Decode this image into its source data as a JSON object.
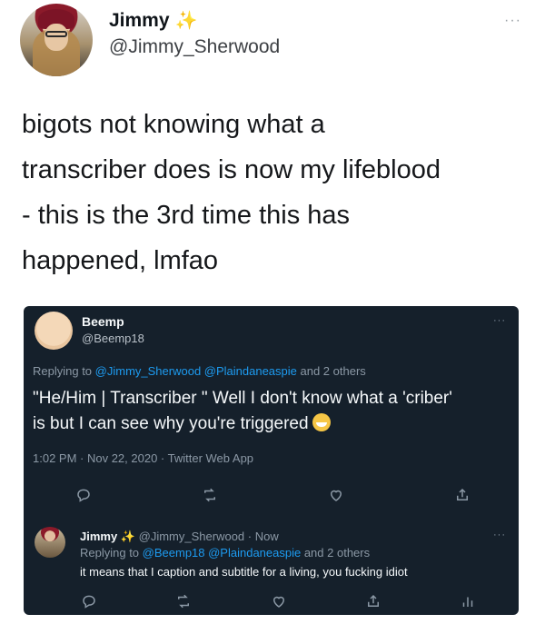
{
  "outer_tweet": {
    "display_name": "Jimmy",
    "verified_sparkle": "✨",
    "handle": "@Jimmy_Sherwood",
    "more": "···",
    "text_lines": [
      "bigots not knowing what a",
      "transcriber does is now my lifeblood",
      "- this is the 3rd time this has",
      "happened, lmfao"
    ]
  },
  "quoted_screenshot": {
    "theme": {
      "background": "#15202b",
      "link": "#1d9bf0",
      "muted": "#8b98a5"
    },
    "beemp_tweet": {
      "display_name": "Beemp",
      "handle": "@Beemp18",
      "more": "···",
      "replying_prefix": "Replying to ",
      "replying_to": "@Jimmy_Sherwood @Plaindaneaspie",
      "replying_suffix": " and 2 others",
      "text_line1": "\"He/Him | Transcriber \" Well I don't know what a 'criber'",
      "text_line2": "is but I can see why you're triggered",
      "emoji": "face-with-tears-of-joy",
      "meta": "1:02 PM · Nov 22, 2020 · Twitter Web App"
    },
    "jimmy_reply": {
      "display_name": "Jimmy",
      "sparkle": "✨",
      "handle_time": "@Jimmy_Sherwood · Now",
      "replying_prefix": "Replying to ",
      "replying_to": "@Beemp18 @Plaindaneaspie",
      "replying_suffix": " and 2 others",
      "text": "it means that I caption and subtitle for a living, you fucking idiot",
      "more": "···"
    }
  }
}
